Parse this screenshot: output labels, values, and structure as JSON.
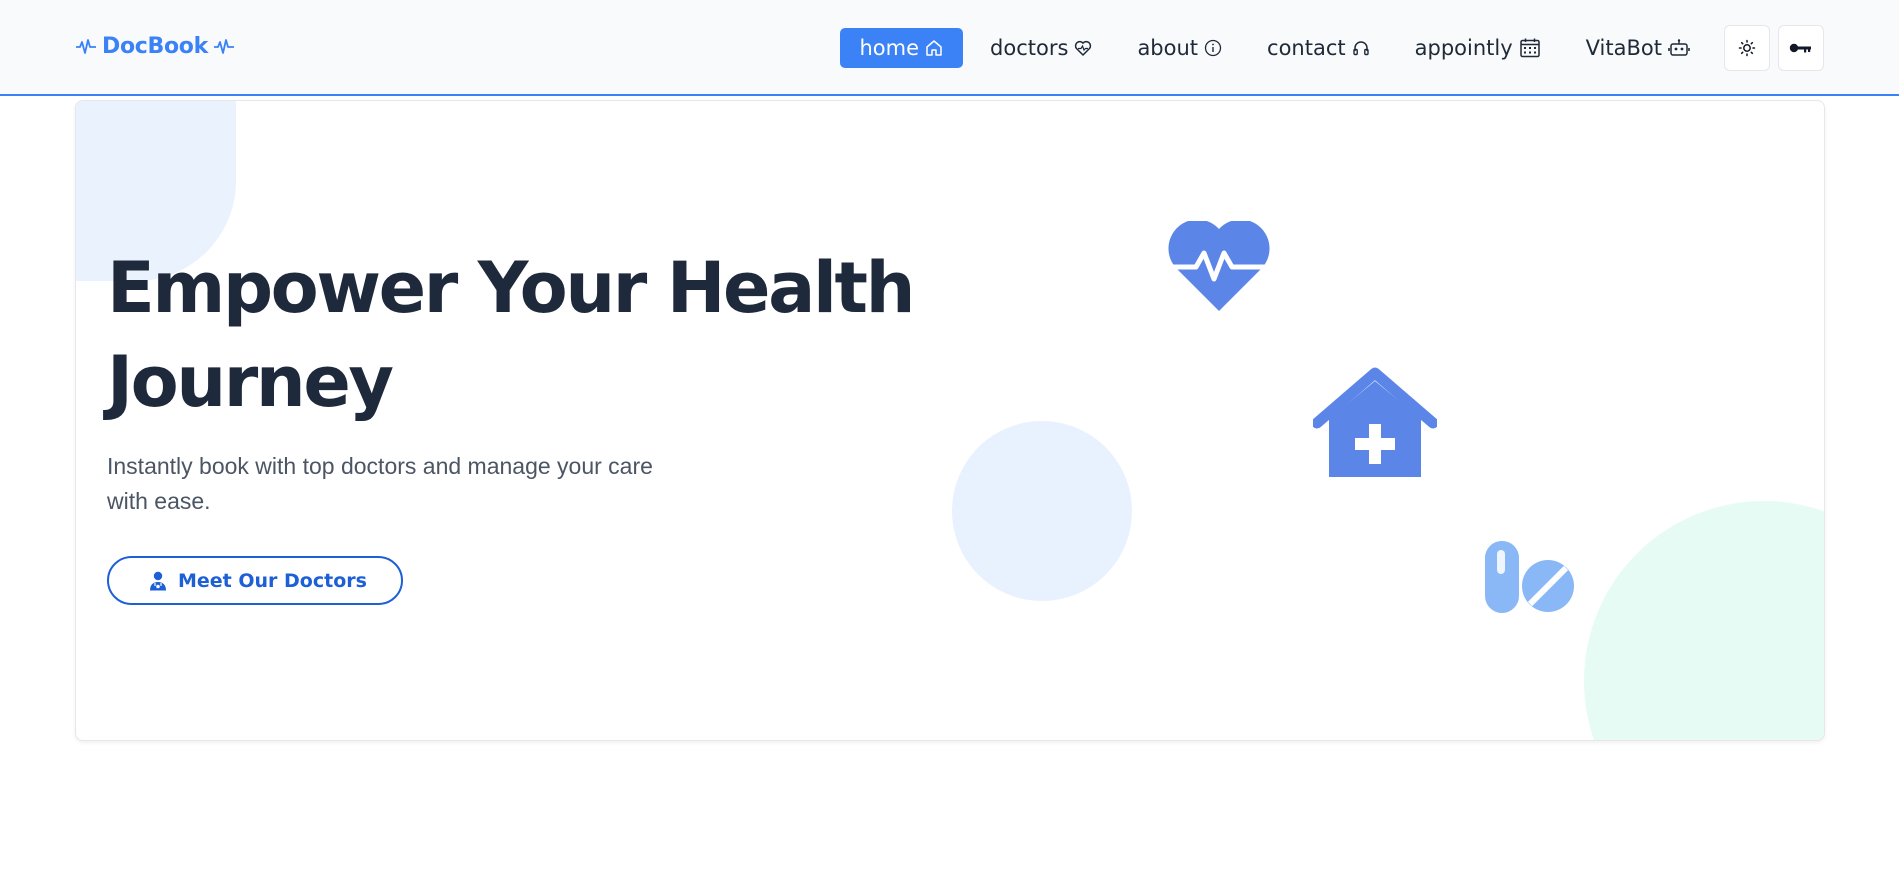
{
  "brand": {
    "name": "DocBook",
    "color": "#3b82f6"
  },
  "nav": {
    "items": [
      {
        "label": "home",
        "icon": "home-icon",
        "active": true
      },
      {
        "label": "doctors",
        "icon": "heart-icon"
      },
      {
        "label": "about",
        "icon": "info-icon"
      },
      {
        "label": "contact",
        "icon": "headphones-icon"
      },
      {
        "label": "appointly",
        "icon": "calendar-icon"
      },
      {
        "label": "VitaBot",
        "icon": "robot-icon"
      }
    ],
    "theme_toggle_icon": "sun-icon",
    "login_icon": "key-icon"
  },
  "hero": {
    "headline": "Empower Your Health Journey",
    "subtext": "Instantly book with top doctors and manage your care with ease.",
    "cta_label": "Meet Our Doctors",
    "cta_icon": "doctor-icon",
    "decorations": [
      "heart-pulse-icon",
      "hospital-icon",
      "pills-icon"
    ]
  },
  "colors": {
    "accent": "#3b82f6",
    "headline": "#1e293b",
    "cta": "#1d5fd6"
  }
}
